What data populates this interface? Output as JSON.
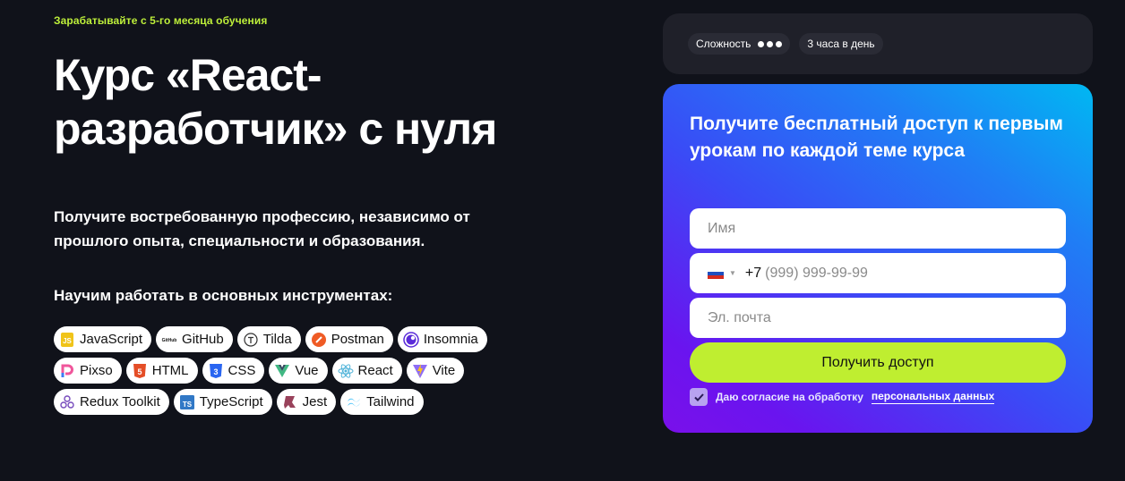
{
  "hero": {
    "eyebrow": "Зарабатывайте с 5-го месяца обучения",
    "title": "Курс «React-разработчик» с нуля",
    "subtitle": "Получите востребованную профессию, независимо от прошлого опыта, специальности и образования.",
    "tools_heading": "Научим работать в основных инструментах:",
    "tools": [
      {
        "label": "JavaScript",
        "icon": "javascript-icon"
      },
      {
        "label": "GitHub",
        "icon": "github-icon"
      },
      {
        "label": "Tilda",
        "icon": "tilda-icon"
      },
      {
        "label": "Postman",
        "icon": "postman-icon"
      },
      {
        "label": "Insomnia",
        "icon": "insomnia-icon"
      },
      {
        "label": "Pixso",
        "icon": "pixso-icon"
      },
      {
        "label": "HTML",
        "icon": "html-icon"
      },
      {
        "label": "CSS",
        "icon": "css-icon"
      },
      {
        "label": "Vue",
        "icon": "vue-icon"
      },
      {
        "label": "React",
        "icon": "react-icon"
      },
      {
        "label": "Vite",
        "icon": "vite-icon"
      },
      {
        "label": "Redux Toolkit",
        "icon": "redux-icon"
      },
      {
        "label": "TypeScript",
        "icon": "typescript-icon"
      },
      {
        "label": "Jest",
        "icon": "jest-icon"
      },
      {
        "label": "Tailwind",
        "icon": "tailwind-icon"
      }
    ]
  },
  "info": {
    "difficulty_label": "Сложность",
    "difficulty_level": 3,
    "difficulty_max": 3,
    "time_label": "3 часа в день"
  },
  "form": {
    "title": "Получите бесплатный доступ к первым урокам по каждой теме курса",
    "name_placeholder": "Имя",
    "phone_country": "RU",
    "phone_prefix": "+7",
    "phone_placeholder": "(999) 999-99-99",
    "email_placeholder": "Эл. почта",
    "submit_label": "Получить доступ",
    "consent_text": "Даю согласие на обработку",
    "consent_link": "персональных данных",
    "consent_checked": true
  },
  "colors": {
    "accent": "#bfee30",
    "background": "#10121a",
    "card": "#1f2029"
  }
}
